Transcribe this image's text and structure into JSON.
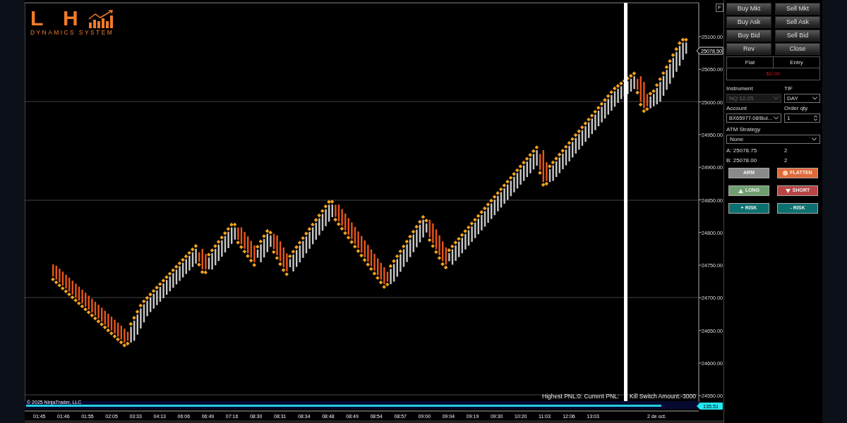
{
  "logo": {
    "letters": "L H",
    "subtitle": "DYNAMICS SYSTEM"
  },
  "chart": {
    "f_button": "F",
    "price_labels": [
      "25100.00",
      "25050.00",
      "25000.00",
      "24950.00",
      "24900.00",
      "24850.00",
      "24800.00",
      "24750.00",
      "24700.00",
      "24650.00",
      "24600.00",
      "24550.00"
    ],
    "current_price": "25078.50",
    "indicator_value": "135.51",
    "copyright": "© 2025 NinjaTrader, LLC",
    "pnl_text": "Highest PNL:0: Current PNL:",
    "kill_switch_text": "Kill Switch Amount:-3000",
    "time_labels": [
      "01:45",
      "01:46",
      "01:55",
      "02:05",
      "03:33",
      "04:13",
      "06:06",
      "06:49",
      "07:16",
      "08:30",
      "08:31",
      "08:34",
      "08:48",
      "08:49",
      "08:54",
      "08:57",
      "09:00",
      "09:04",
      "09:19",
      "09:30",
      "10:20",
      "11:03",
      "12:06",
      "13:03",
      "2 de oct."
    ]
  },
  "panel": {
    "order_buttons": [
      {
        "label": "Buy Mkt"
      },
      {
        "label": "Sell Mkt"
      },
      {
        "label": "Buy Ask"
      },
      {
        "label": "Sell Ask"
      },
      {
        "label": "Buy Bid"
      },
      {
        "label": "Sell Bid"
      },
      {
        "label": "Rev"
      },
      {
        "label": "Close"
      }
    ],
    "position": {
      "status": "Flat",
      "entry": "Entry",
      "pnl": "$0.00"
    },
    "instrument": {
      "label": "Instrument",
      "value": "NQ 12-25",
      "disabled": true
    },
    "tif": {
      "label": "TIF",
      "value": "DAY"
    },
    "account": {
      "label": "Account",
      "value": "BX65977-08!Bul..."
    },
    "order_qty": {
      "label": "Order qty",
      "value": "1"
    },
    "atm_strategy": {
      "label": "ATM Strategy",
      "value": "None"
    },
    "quotes": [
      {
        "label": "A:",
        "price": "25078.75",
        "size": "2"
      },
      {
        "label": "B:",
        "price": "25078.00",
        "size": "2"
      }
    ],
    "actions": [
      {
        "kind": "plain",
        "label": "ARM",
        "color": "#8a8a8a"
      },
      {
        "kind": "flatten",
        "label": "FLATTEN",
        "color": "#e06a3a"
      },
      {
        "kind": "long",
        "label": "LONG",
        "color": "#6f9f6f"
      },
      {
        "kind": "short",
        "label": "SHORT",
        "color": "#b84545"
      },
      {
        "kind": "plain",
        "label": "+ RISK",
        "color": "#0d7070"
      },
      {
        "kind": "plain",
        "label": "- RISK",
        "color": "#0d7070"
      }
    ]
  }
}
